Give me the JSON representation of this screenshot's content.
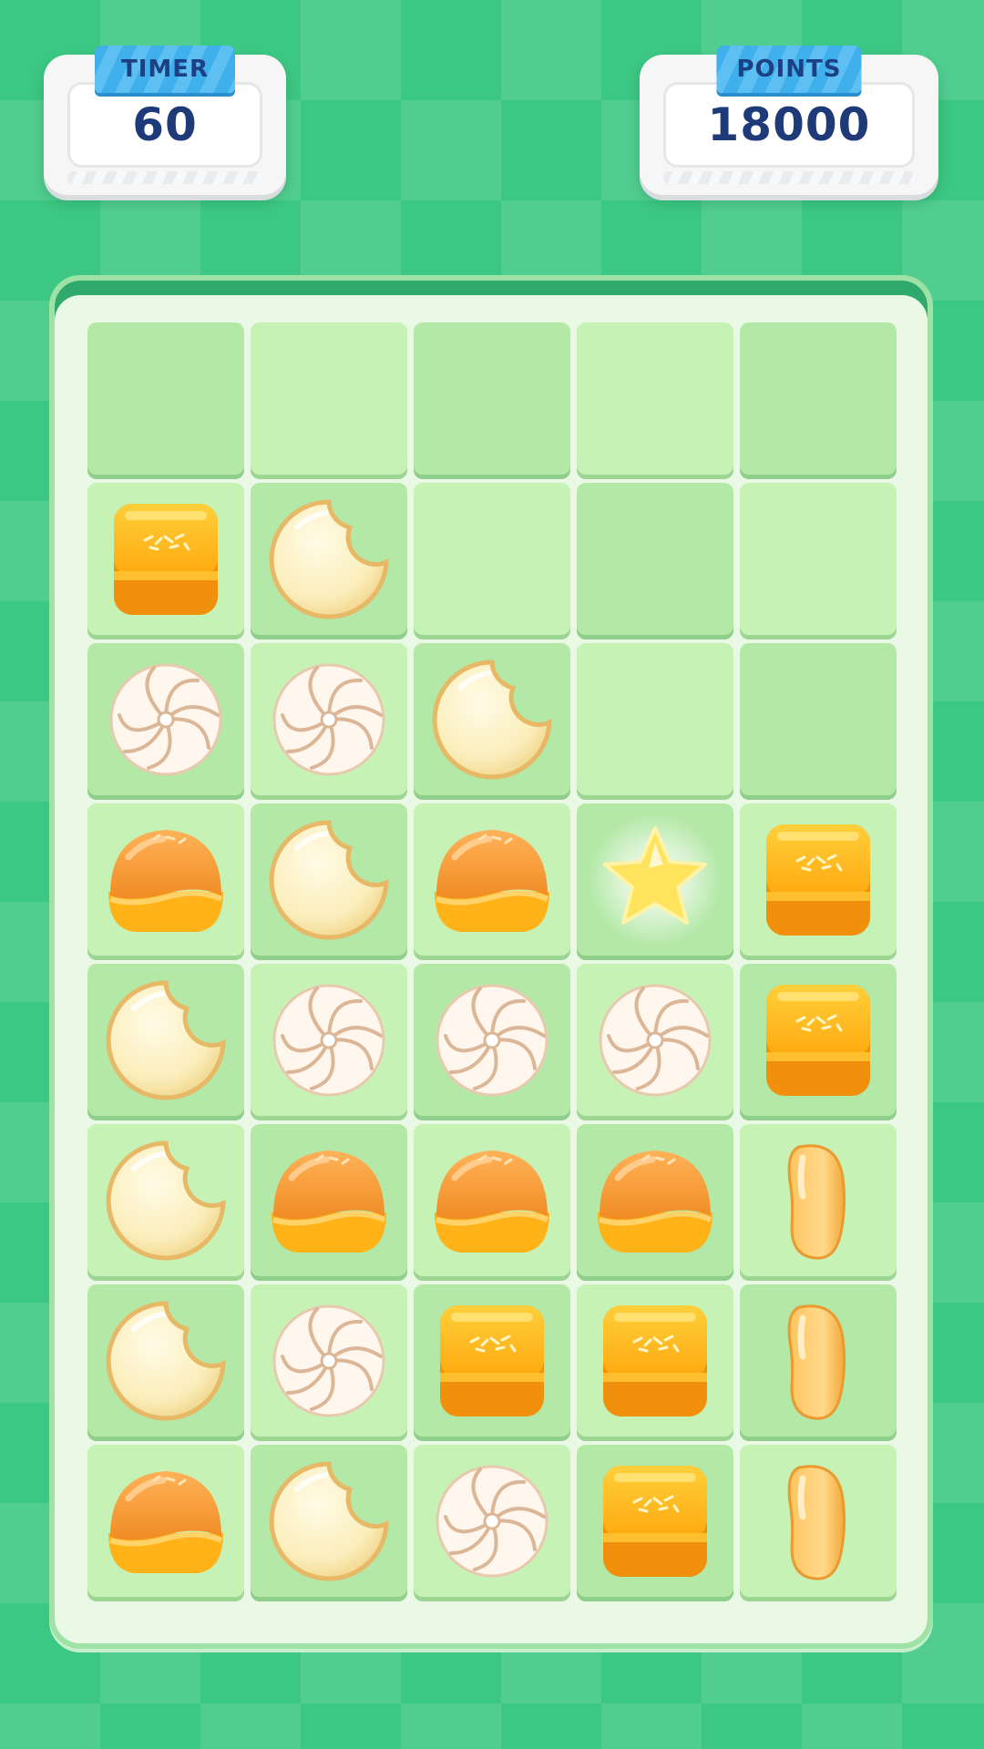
{
  "hud": {
    "timer_label": "TIMER",
    "timer_value": "60",
    "points_label": "POINTS",
    "points_value": "18000"
  },
  "colors": {
    "background": "#3cc782",
    "board": "#eaf9e6",
    "tile_dark": "#b3e8a6",
    "tile_light": "#c6f2b6",
    "hud_text": "#1e3a78",
    "hud_tag": "#3fb0ec"
  },
  "board": {
    "columns": 5,
    "rows": [
      [
        "empty",
        "empty",
        "empty",
        "empty",
        "empty"
      ],
      [
        "square-jelly",
        "moon-cookie",
        "empty",
        "empty",
        "empty"
      ],
      [
        "swirl-meringue",
        "swirl-meringue",
        "moon-cookie",
        "empty",
        "empty"
      ],
      [
        "cream-puff",
        "moon-cookie",
        "cream-puff",
        "star-bonus",
        "square-jelly"
      ],
      [
        "moon-cookie",
        "swirl-meringue",
        "swirl-meringue",
        "swirl-meringue",
        "square-jelly"
      ],
      [
        "moon-cookie",
        "cream-puff",
        "cream-puff",
        "cream-puff",
        "jelly-bean"
      ],
      [
        "moon-cookie",
        "swirl-meringue",
        "square-jelly",
        "square-jelly",
        "jelly-bean"
      ],
      [
        "cream-puff",
        "moon-cookie",
        "swirl-meringue",
        "square-jelly",
        "jelly-bean"
      ]
    ]
  }
}
